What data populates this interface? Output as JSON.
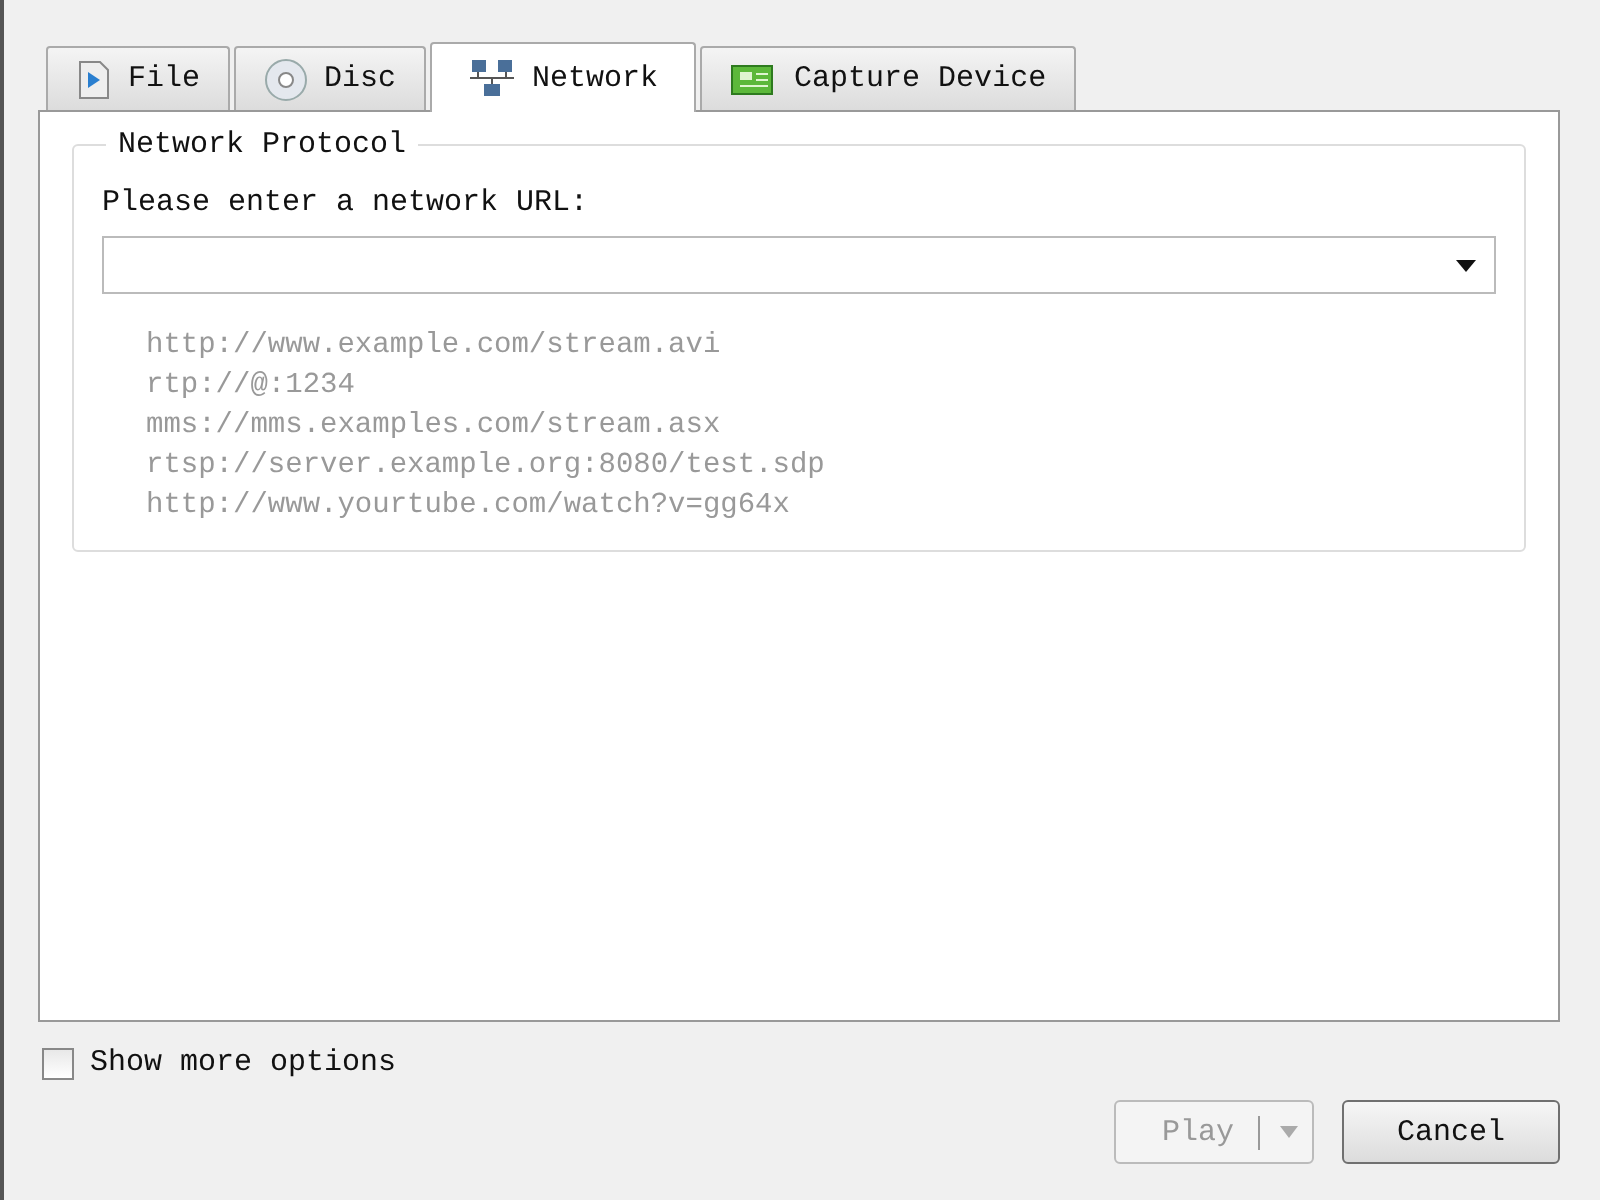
{
  "tabs": [
    {
      "label": "File",
      "kind": "file",
      "selected": false
    },
    {
      "label": "Disc",
      "kind": "disc",
      "selected": false
    },
    {
      "label": "Network",
      "kind": "network",
      "selected": true
    },
    {
      "label": "Capture Device",
      "kind": "capture",
      "selected": false
    }
  ],
  "group": {
    "title": "Network Protocol",
    "prompt": "Please enter a network URL:",
    "examples": [
      "http://www.example.com/stream.avi",
      "rtp://@:1234",
      "mms://mms.examples.com/stream.asx",
      "rtsp://server.example.org:8080/test.sdp",
      "http://www.yourtube.com/watch?v=gg64x"
    ]
  },
  "show_more": {
    "label": "Show more options",
    "checked": false
  },
  "buttons": [
    {
      "label": "Play",
      "kind": "split",
      "disabled": true
    },
    {
      "label": "Cancel",
      "kind": "plain",
      "disabled": false
    }
  ]
}
